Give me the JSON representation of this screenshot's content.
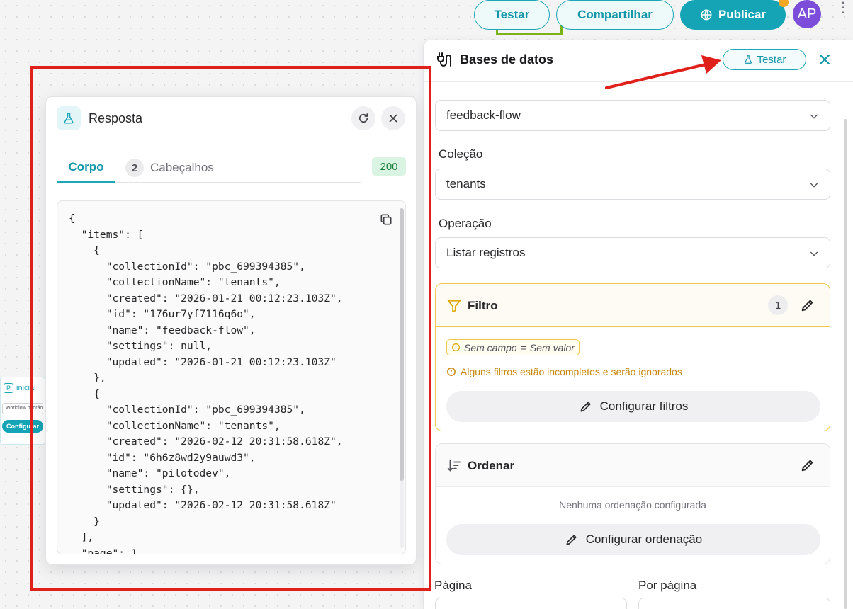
{
  "toolbar": {
    "testar_label": "Testar",
    "compartilhar_label": "Compartilhar",
    "publicar_label": "Publicar",
    "avatar_initials": "AP"
  },
  "canvas_node": {
    "title": "inicial",
    "input_value": "Workflow padrão",
    "button_label": "Configurar"
  },
  "response": {
    "title": "Resposta",
    "tabs": [
      {
        "label": "Corpo"
      },
      {
        "label": "Cabeçalhos",
        "count": "2"
      }
    ],
    "status_code": "200",
    "body": "{\n  \"items\": [\n    {\n      \"collectionId\": \"pbc_699394385\",\n      \"collectionName\": \"tenants\",\n      \"created\": \"2026-01-21 00:12:23.103Z\",\n      \"id\": \"176ur7yf7116q6o\",\n      \"name\": \"feedback-flow\",\n      \"settings\": null,\n      \"updated\": \"2026-01-21 00:12:23.103Z\"\n    },\n    {\n      \"collectionId\": \"pbc_699394385\",\n      \"collectionName\": \"tenants\",\n      \"created\": \"2026-02-12 20:31:58.618Z\",\n      \"id\": \"6h6z8wd2y9auwd3\",\n      \"name\": \"pilotodev\",\n      \"settings\": {},\n      \"updated\": \"2026-02-12 20:31:58.618Z\"\n    }\n  ],\n  \"page\": 1"
  },
  "panel": {
    "title": "Bases de datos",
    "testar_label": "Testar",
    "database_value": "feedback-flow",
    "collection_label": "Coleção",
    "collection_value": "tenants",
    "operation_label": "Operação",
    "operation_value": "Listar registros",
    "filter": {
      "title": "Filtro",
      "count": "1",
      "chip_field": "Sem campo",
      "chip_operator": "=",
      "chip_value": "Sem valor",
      "warning": "Alguns filtros estão incompletos e serão ignorados",
      "configure_label": "Configurar filtros"
    },
    "sort": {
      "title": "Ordenar",
      "empty": "Nenhuma ordenação configurada",
      "configure_label": "Configurar ordenação"
    },
    "page_label": "Página",
    "per_page_label": "Por página"
  },
  "colors": {
    "accent": "#14a4b5",
    "annotation": "#e0201b",
    "filter_border": "#f0c94a",
    "warning": "#c7870a",
    "status_ok": "#16803c"
  }
}
